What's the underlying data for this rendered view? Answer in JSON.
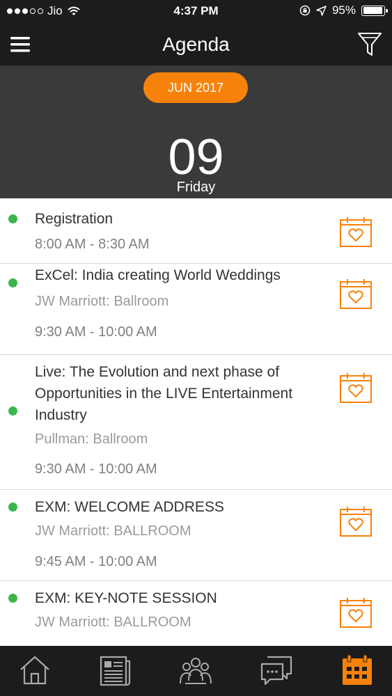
{
  "status_bar": {
    "carrier": "Jio",
    "time": "4:37 PM",
    "battery": "95%",
    "battery_level": 0.95,
    "signal_bars": 3,
    "signal_total": 5
  },
  "nav": {
    "title": "Agenda",
    "menu_icon": "hamburger-icon",
    "filter_icon": "filter-icon"
  },
  "date_header": {
    "month": "JUN 2017",
    "day": "09",
    "weekday": "Friday"
  },
  "sessions": [
    {
      "title": "Registration",
      "venue": "",
      "time": "8:00 AM - 8:30 AM",
      "status": "live"
    },
    {
      "title": "ExCel: India creating World Weddings",
      "venue": "JW Marriott: Ballroom",
      "time": "9:30 AM - 10:00 AM",
      "status": "live"
    },
    {
      "title": "Live: The Evolution and next phase of Opportunities in the LIVE Entertainment Industry",
      "venue": "Pullman: Ballroom",
      "time": "9:30 AM - 10:00 AM",
      "status": "live"
    },
    {
      "title": "EXM: WELCOME ADDRESS",
      "venue": "JW Marriott: BALLROOM",
      "time": "9:45 AM - 10:00 AM",
      "status": "live"
    },
    {
      "title": "EXM: KEY-NOTE SESSION",
      "venue": "JW Marriott: BALLROOM",
      "time": "",
      "status": "live"
    }
  ],
  "tabs": [
    {
      "icon": "home-icon",
      "active": false
    },
    {
      "icon": "news-icon",
      "active": false
    },
    {
      "icon": "people-icon",
      "active": false
    },
    {
      "icon": "chat-icon",
      "active": false
    },
    {
      "icon": "calendar-icon",
      "active": true
    }
  ],
  "colors": {
    "accent": "#f7820b",
    "live_dot": "#3cb54a",
    "bar_background": "#1c1c1c",
    "header_background": "#3a3a3a"
  }
}
